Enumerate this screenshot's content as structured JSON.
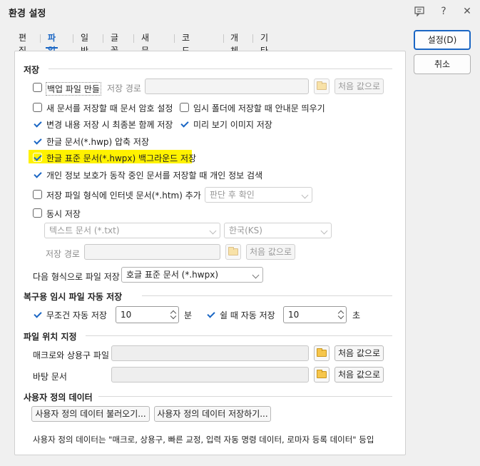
{
  "window": {
    "title": "환경 설정"
  },
  "titlebar_icons": {
    "chat": "chat-icon",
    "help": "?",
    "close": "✕"
  },
  "tabs": [
    {
      "label": "편집"
    },
    {
      "label": "파일",
      "active": true
    },
    {
      "label": "일반"
    },
    {
      "label": "글꼴"
    },
    {
      "label": "새 문서"
    },
    {
      "label": "코드 형식"
    },
    {
      "label": "개체"
    },
    {
      "label": "기타"
    }
  ],
  "buttons": {
    "ok": "설정(D)",
    "cancel": "취소"
  },
  "save": {
    "section": "저장",
    "backup": {
      "label": "백업 파일 만들",
      "checked": false
    },
    "save_path_label": "저장 경로",
    "default_btn": "처음 값으로",
    "password_prompt": {
      "label": "새 문서를 저장할 때 문서 암호 설정",
      "checked": false
    },
    "temp_folder_notice": {
      "label": "임시 폴더에 저장할 때 안내문 띄우기",
      "checked": false
    },
    "save_with_latest": {
      "label": "변경 내용 저장 시 최종본 함께 저장",
      "checked": true
    },
    "save_preview": {
      "label": "미리 보기 이미지 저장",
      "checked": true
    },
    "compress_hwp": {
      "label": "한글 문서(*.hwp) 압축 저장",
      "checked": true
    },
    "bg_save_hwpx": {
      "label": "한글 표준 문서(*.hwpx) 백그라운드 저장",
      "checked": true
    },
    "privacy_check": {
      "label": "개인 정보 보호가 동작 중인 문서를 저장할 때 개인 정보 검색",
      "checked": true
    },
    "add_htm": {
      "label": "저장 파일 형식에 인터넷 문서(*.htm) 추가",
      "checked": false
    },
    "htm_select": "판단 후 확인",
    "simul_save": {
      "label": "동시 저장",
      "checked": false
    },
    "simul_format": "텍스트 문서 (*.txt)",
    "simul_encoding": "한국(KS)",
    "simul_path_label": "저장 경로",
    "save_as_label": "다음 형식으로 파일 저장",
    "save_as_value": "호글 표준 문서 (*.hwpx)"
  },
  "autosave": {
    "section": "복구용 임시 파일 자동 저장",
    "always": {
      "label": "무조건 자동 저장",
      "checked": true,
      "value": "10",
      "unit": "분"
    },
    "idle": {
      "label": "쉴 때 자동 저장",
      "checked": true,
      "value": "10",
      "unit": "초"
    }
  },
  "file_location": {
    "section": "파일 위치 지정",
    "macro_label": "매크로와 상용구 파일",
    "template_label": "바탕 문서",
    "default_btn": "처음 값으로"
  },
  "user_data": {
    "section": "사용자 정의 데이터",
    "load_btn": "사용자 정의 데이터 불러오기...",
    "save_btn": "사용자 정의 데이터 저장하기...",
    "note": "사용자 정의 데이터는 \"매크로, 상용구, 빠른 교정, 입력 자동 명령 데이터, 로마자 등록 데이터\" 등입"
  }
}
